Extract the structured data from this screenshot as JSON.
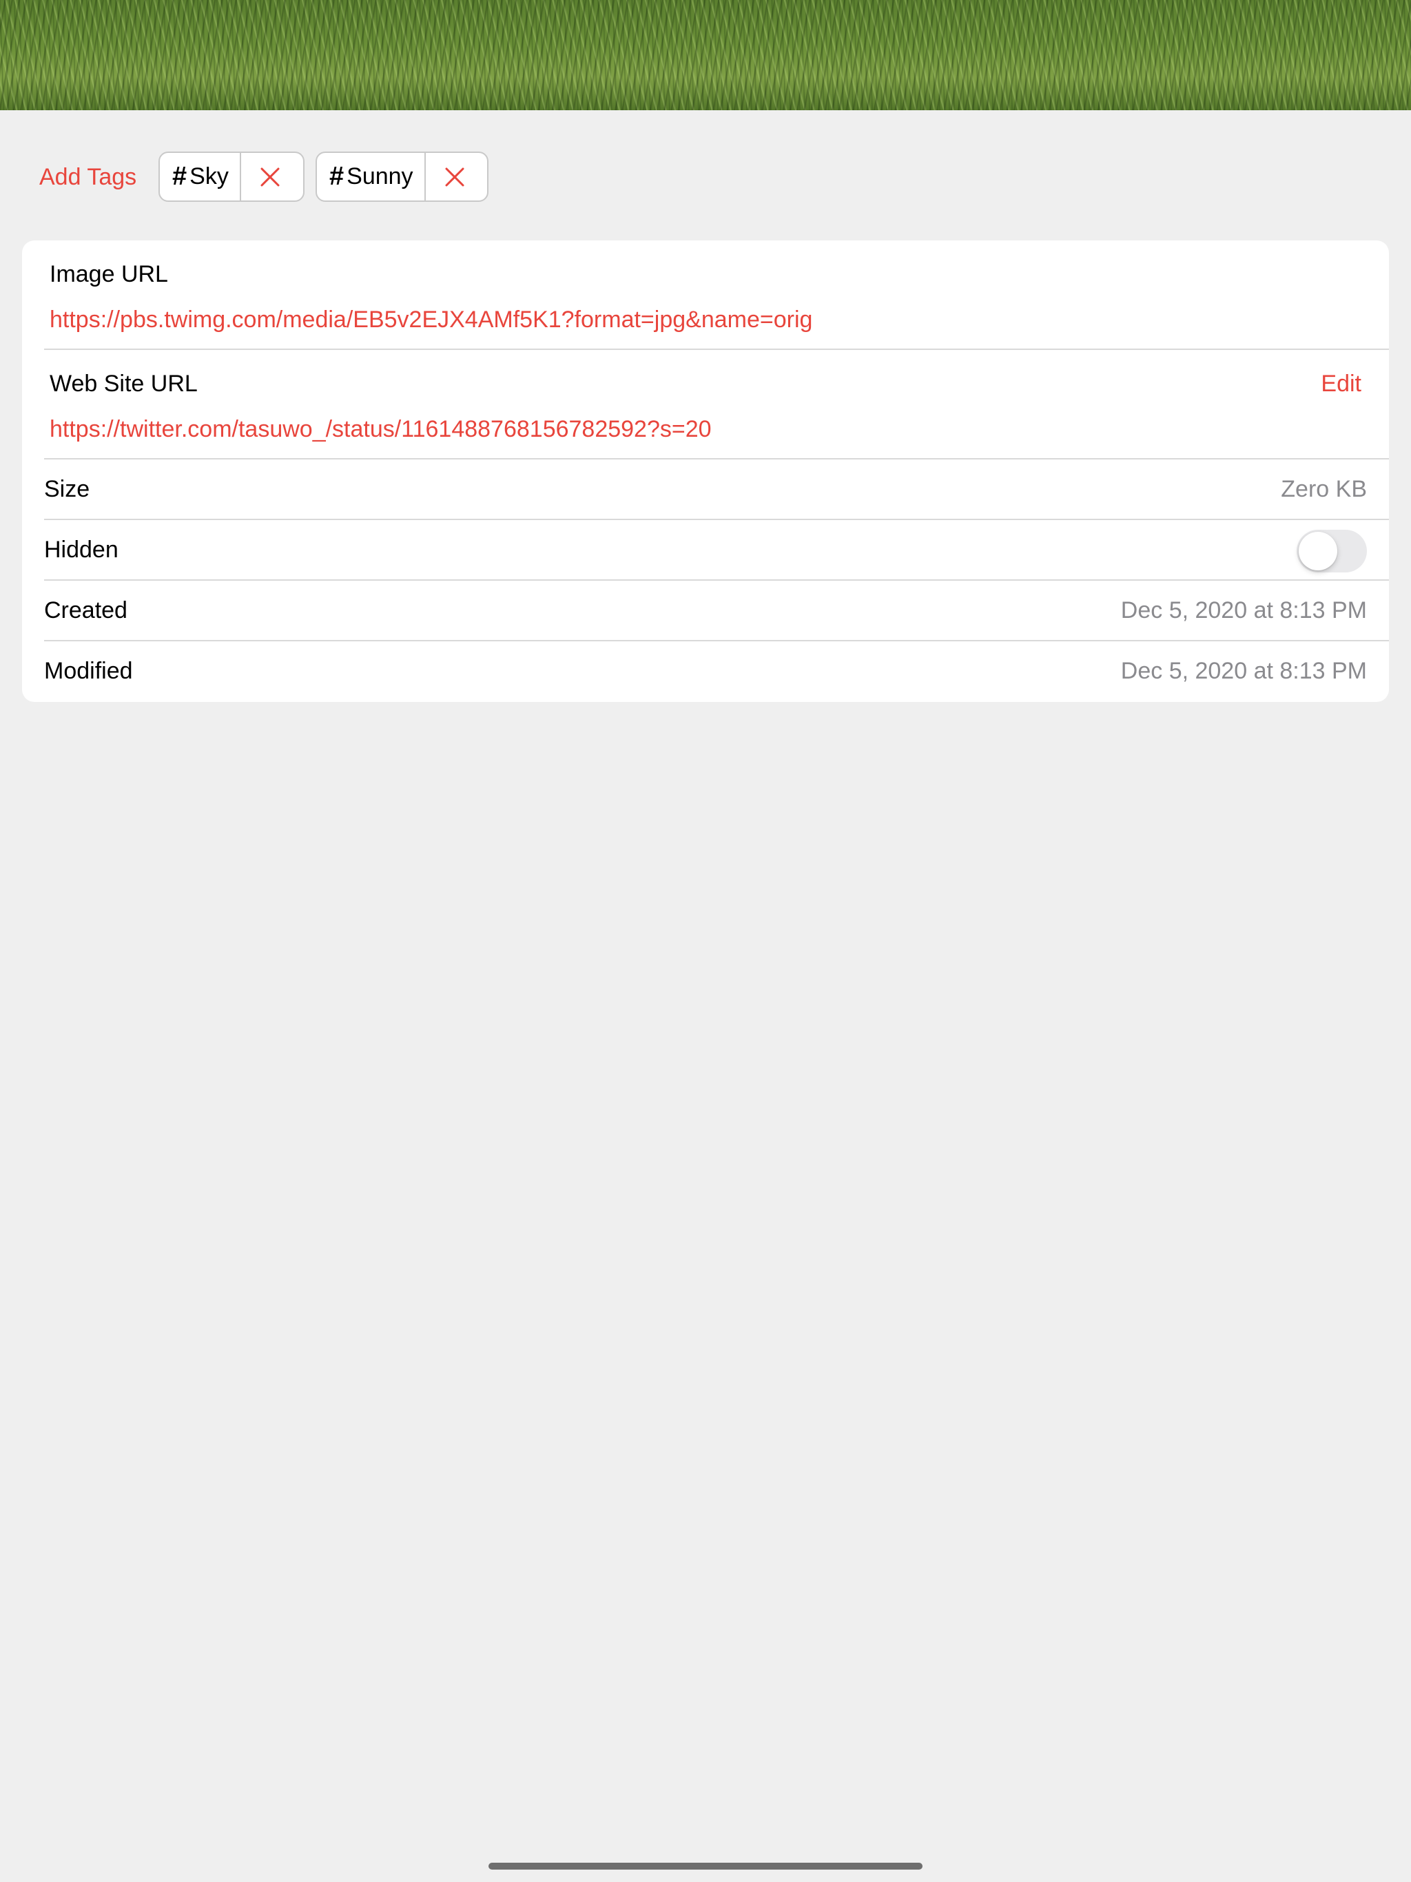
{
  "colors": {
    "accent": "#e8453c",
    "background": "#efefef",
    "card": "#ffffff",
    "secondary_text": "#8a8a8e"
  },
  "tags": {
    "add_label": "Add Tags",
    "items": [
      {
        "hash": "#",
        "label": "Sky",
        "remove_icon": "close-icon"
      },
      {
        "hash": "#",
        "label": "Sunny",
        "remove_icon": "close-icon"
      }
    ]
  },
  "details": {
    "image_url": {
      "label": "Image URL",
      "value": "https://pbs.twimg.com/media/EB5v2EJX4AMf5K1?format=jpg&name=orig"
    },
    "website_url": {
      "label": "Web Site URL",
      "value": "https://twitter.com/tasuwo_/status/1161488768156782592?s=20",
      "edit_label": "Edit"
    },
    "size": {
      "label": "Size",
      "value": "Zero KB"
    },
    "hidden": {
      "label": "Hidden",
      "on": false
    },
    "created": {
      "label": "Created",
      "value": "Dec 5, 2020 at 8:13 PM"
    },
    "modified": {
      "label": "Modified",
      "value": "Dec 5, 2020 at 8:13 PM"
    }
  }
}
